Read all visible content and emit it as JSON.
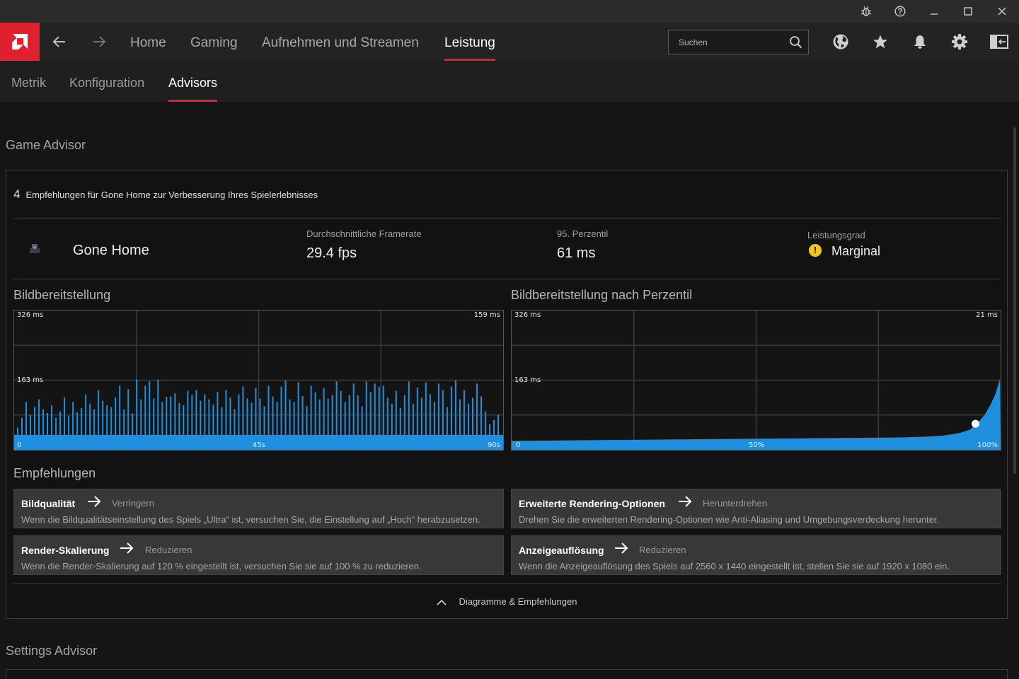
{
  "titlebar": {
    "icons": [
      "bug-icon",
      "help-icon",
      "minimize-icon",
      "maximize-icon",
      "close-icon"
    ]
  },
  "nav": {
    "logo": "amd-logo",
    "back": "back-arrow-icon",
    "forward": "forward-arrow-icon",
    "items": [
      "Home",
      "Gaming",
      "Aufnehmen und Streamen",
      "Leistung"
    ],
    "active": "Leistung",
    "search_placeholder": "Suchen",
    "right_icons": [
      "globe-icon",
      "star-icon",
      "bell-icon",
      "gear-icon",
      "sidebar-icon"
    ]
  },
  "subnav": {
    "items": [
      "Metrik",
      "Konfiguration",
      "Advisors"
    ],
    "active": "Advisors"
  },
  "game_advisor": {
    "section_title": "Game Advisor",
    "count": "4",
    "headline": "Empfehlungen für Gone Home zur Verbesserung Ihres Spielerlebnisses",
    "game_name": "Gone Home",
    "stats": {
      "avg_framerate_label": "Durchschnittliche Framerate",
      "avg_framerate_value": "29.4 fps",
      "percentile_label": "95. Perzentil",
      "percentile_value": "61 ms",
      "level_label": "Leistungsgrad",
      "level_value": "Marginal"
    },
    "charts": [
      {
        "title": "Bildbereitstellung",
        "y_top": "326  ms",
        "y_mid": "163  ms",
        "corner_value": "159  ms",
        "x_ticks": [
          "0",
          "45s",
          "90s"
        ]
      },
      {
        "title": "Bildbereitstellung nach Perzentil",
        "y_top": "326  ms",
        "y_mid": "163  ms",
        "corner_value": "21  ms",
        "x_ticks": [
          "0",
          "50%",
          "100%"
        ]
      }
    ],
    "recommendations_title": "Empfehlungen",
    "recommendations": [
      {
        "name": "Bildqualität",
        "action": "Verringern",
        "desc": "Wenn die Bildqualitätseinstellung des Spiels „Ultra“ ist, versuchen Sie, die Einstellung auf „Hoch“ herabzusetzen."
      },
      {
        "name": "Erweiterte Rendering-Optionen",
        "action": "Herunterdrehen",
        "desc": "Drehen Sie die erweiterten Rendering-Optionen wie Anti-Aliasing und Umgebungsverdeckung herunter."
      },
      {
        "name": "Render-Skalierung",
        "action": "Reduzieren",
        "desc": "Wenn die Render-Skalierung auf 120 % eingestellt ist, versuchen Sie sie auf 100 % zu reduzieren."
      },
      {
        "name": "Anzeigeauflösung",
        "action": "Reduzieren",
        "desc": "Wenn die Anzeigeauflösung des Spiels auf 2560 x 1440 eingestellt ist, stellen Sie sie auf 1920 x 1080 ein."
      }
    ],
    "collapse_label": "Diagramme & Empfehlungen"
  },
  "settings_advisor": {
    "section_title": "Settings Advisor"
  },
  "colors": {
    "accent": "#e0202f",
    "chart_fill": "#1f8fe0",
    "warning": "#f5c518"
  },
  "chart_data": [
    {
      "type": "bar",
      "title": "Bildbereitstellung",
      "xlabel": "",
      "ylabel": "",
      "x_ticks": [
        "0",
        "45s",
        "90s"
      ],
      "ylim": [
        0,
        326
      ],
      "y_ticks": [
        163,
        326
      ],
      "baseline_ms": 30,
      "spikes_ms": [
        52,
        75,
        112,
        82,
        100,
        118,
        95,
        86,
        104,
        75,
        90,
        122,
        80,
        112,
        88,
        98,
        130,
        108,
        95,
        140,
        115,
        104,
        100,
        122,
        150,
        95,
        142,
        85,
        165,
        118,
        150,
        160,
        120,
        164,
        112,
        124,
        125,
        132,
        110,
        105,
        138,
        128,
        140,
        115,
        130,
        118,
        106,
        136,
        100,
        140,
        122,
        95,
        130,
        148,
        120,
        110,
        145,
        120,
        102,
        150,
        125,
        112,
        148,
        162,
        118,
        112,
        158,
        126,
        102,
        150,
        135,
        118,
        145,
        120,
        128,
        160,
        138,
        112,
        128,
        155,
        128,
        102,
        160,
        135,
        155,
        148,
        150,
        122,
        108,
        138,
        98,
        128,
        160,
        108,
        146,
        122,
        158,
        130,
        112,
        155,
        140,
        100,
        148,
        162,
        118,
        140,
        108,
        122,
        155,
        125,
        90,
        60,
        70,
        82
      ]
    },
    {
      "type": "area",
      "title": "Bildbereitstellung nach Perzentil",
      "xlabel": "",
      "ylabel": "",
      "x_ticks": [
        "0",
        "50%",
        "100%"
      ],
      "ylim": [
        0,
        326
      ],
      "y_ticks": [
        163,
        326
      ],
      "x": [
        0,
        10,
        20,
        30,
        40,
        50,
        60,
        70,
        80,
        85,
        88,
        90,
        92,
        94,
        95,
        96,
        97,
        98,
        99,
        100
      ],
      "y": [
        21,
        22,
        23,
        24,
        25,
        26,
        27,
        28,
        29,
        31,
        33,
        36,
        40,
        48,
        61,
        70,
        84,
        104,
        128,
        165
      ],
      "marker": {
        "x": 95,
        "y": 61
      }
    }
  ]
}
